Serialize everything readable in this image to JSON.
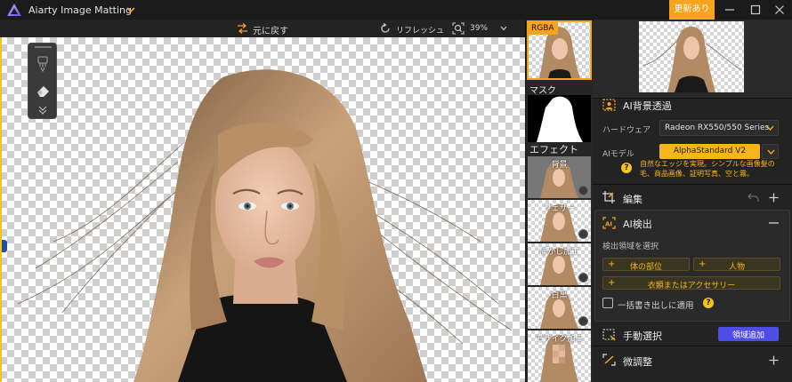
{
  "app": {
    "title": "Aiarty Image Matting",
    "update_label": "更新あり",
    "accent_color": "#f7a31c"
  },
  "toolbar": {
    "undo_label": "元に戻す",
    "refresh_label": "リフレッシュ",
    "zoom_value": "39%"
  },
  "thumbnails": {
    "rgba_label": "RGBA",
    "mask_label": "マスク",
    "effect_header": "エフェクト",
    "effects": [
      {
        "label": "背景"
      },
      {
        "label": "フェザー"
      },
      {
        "label": "ぼかし加工"
      },
      {
        "label": "白黒"
      },
      {
        "label": "モザイク加工"
      }
    ]
  },
  "panel": {
    "ai_bg": {
      "title": "AI背景透過",
      "hardware_label": "ハードウェア",
      "hardware_value": "Radeon RX550/550 Series",
      "model_label": "AIモデル",
      "model_value": "AlphaStandard  V2",
      "model_desc": "自然なエッジを実現。シンプルな画像髪の毛、商品画像、証明写真、空と霧。"
    },
    "edit": {
      "title": "編集"
    },
    "ai_detect": {
      "title": "AI検出",
      "region_label": "検出領域を選択",
      "pills": [
        {
          "label": "体の部位"
        },
        {
          "label": "人物"
        },
        {
          "label": "衣類またはアクセサリー"
        }
      ],
      "batch_label": "一括書き出しに適用"
    },
    "manual": {
      "title": "手動選択",
      "add_region_label": "領域追加"
    },
    "fine": {
      "title": "微調整"
    }
  }
}
